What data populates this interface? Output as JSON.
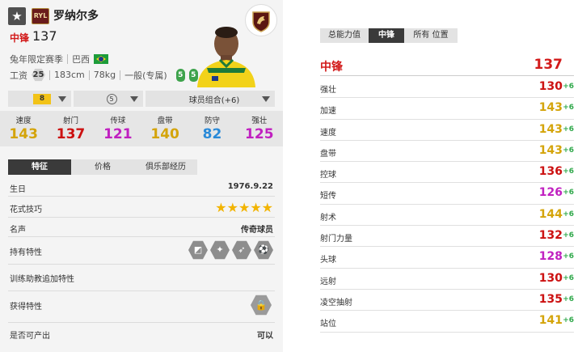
{
  "player": {
    "season_badge": "RYL",
    "name": "罗纳尔多",
    "position": "中锋",
    "ovr": "137",
    "season": "兔年限定赛季",
    "nation": "巴西",
    "wage_label": "工资",
    "wage": "25",
    "height": "183cm",
    "weight": "78kg",
    "body_type": "一般(专属)",
    "weak_foot_left": "5",
    "weak_foot_right": "5"
  },
  "selectors": {
    "upgrade_level": "8",
    "reinforce": "5",
    "combo_label": "球员组合(+6)"
  },
  "summary_stats": [
    {
      "label": "速度",
      "value": "143",
      "color": "#d4a40a"
    },
    {
      "label": "射门",
      "value": "137",
      "color": "#cc1111"
    },
    {
      "label": "传球",
      "value": "121",
      "color": "#c020c0"
    },
    {
      "label": "盘带",
      "value": "140",
      "color": "#d4a40a"
    },
    {
      "label": "防守",
      "value": "82",
      "color": "#2a8ad8"
    },
    {
      "label": "强壮",
      "value": "125",
      "color": "#c020c0"
    }
  ],
  "left_tabs": [
    "特征",
    "价格",
    "俱乐部经历"
  ],
  "details": {
    "birthday_label": "生日",
    "birthday": "1976.9.22",
    "skill_moves_label": "花式技巧",
    "skill_stars": "★★★★★",
    "reputation_label": "名声",
    "reputation": "传奇球员",
    "traits_label": "持有特性",
    "training_traits_label": "训练助教追加特性",
    "acquired_traits_label": "获得特性",
    "tradable_label": "是否可产出",
    "tradable": "可以"
  },
  "right_tabs": [
    "总能力值",
    "中锋",
    "所有 位置"
  ],
  "position_rating": {
    "label": "中锋",
    "value": "137"
  },
  "attributes": [
    {
      "label": "强壮",
      "value": "130",
      "bonus": "+6",
      "color": "#cc1111"
    },
    {
      "label": "加速",
      "value": "143",
      "bonus": "+6",
      "color": "#d4a40a"
    },
    {
      "label": "速度",
      "value": "143",
      "bonus": "+6",
      "color": "#d4a40a"
    },
    {
      "label": "盘带",
      "value": "143",
      "bonus": "+6",
      "color": "#d4a40a"
    },
    {
      "label": "控球",
      "value": "136",
      "bonus": "+6",
      "color": "#cc1111"
    },
    {
      "label": "短传",
      "value": "126",
      "bonus": "+6",
      "color": "#c020c0"
    },
    {
      "label": "射术",
      "value": "144",
      "bonus": "+6",
      "color": "#d4a40a"
    },
    {
      "label": "射门力量",
      "value": "132",
      "bonus": "+6",
      "color": "#cc1111"
    },
    {
      "label": "头球",
      "value": "128",
      "bonus": "+6",
      "color": "#c020c0"
    },
    {
      "label": "远射",
      "value": "130",
      "bonus": "+6",
      "color": "#cc1111"
    },
    {
      "label": "凌空抽射",
      "value": "135",
      "bonus": "+6",
      "color": "#cc1111"
    },
    {
      "label": "站位",
      "value": "141",
      "bonus": "+6",
      "color": "#d4a40a"
    }
  ]
}
